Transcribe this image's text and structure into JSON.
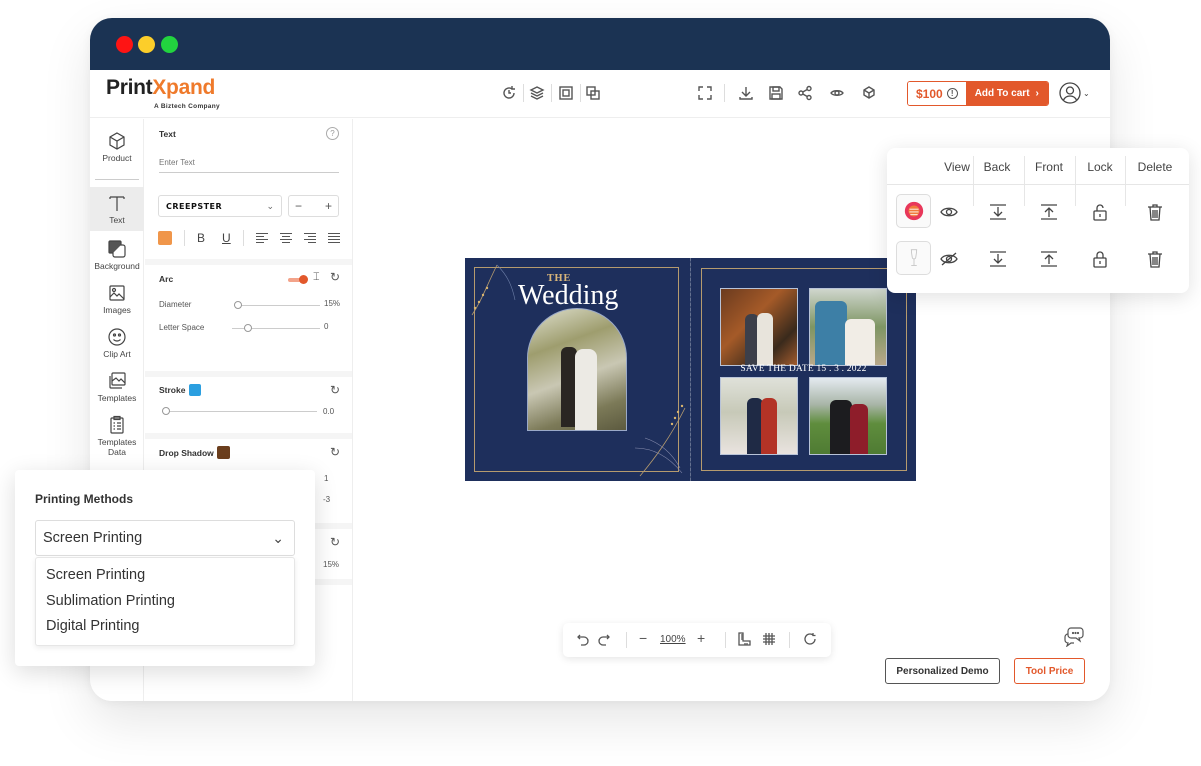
{
  "window": {
    "controls": [
      "close",
      "minimize",
      "maximize"
    ]
  },
  "brand": {
    "logo_main": "Print",
    "logo_accent": "Xpand",
    "tagline": "A Biztech Company",
    "accent_color": "#e2582b"
  },
  "toolbar": {
    "left_icons": [
      "refresh-icon",
      "layers-icon",
      "group-icon",
      "ungroup-icon"
    ],
    "right_icons": [
      "fullscreen-icon",
      "download-icon",
      "save-icon",
      "share-icon",
      "preview-icon",
      "3d-view-icon"
    ],
    "price": "$100",
    "info_symbol": "!",
    "add_to_cart": "Add To cart",
    "add_to_cart_chevron": "›",
    "user_chevron": "⌄"
  },
  "sidebar": {
    "items": [
      {
        "label": "Product",
        "icon": "cube-icon"
      },
      {
        "label": "Text",
        "icon": "text-icon",
        "active": true
      },
      {
        "label": "Background",
        "icon": "background-icon"
      },
      {
        "label": "Images",
        "icon": "image-icon"
      },
      {
        "label": "Clip Art",
        "icon": "smiley-icon"
      },
      {
        "label": "Templates",
        "icon": "templates-icon"
      },
      {
        "label": "Templates",
        "label2": "Data",
        "icon": "clipboard-list-icon"
      }
    ]
  },
  "text_panel": {
    "title": "Text",
    "help": "?",
    "input_placeholder": "Enter Text",
    "input_value": "",
    "font": "CREEPSTER",
    "font_chevron": "⌄",
    "stepper_minus": "−",
    "stepper_plus": "+",
    "text_color": "#f0964a",
    "bold": "B",
    "underline": "U",
    "arc": {
      "title": "Arc",
      "enabled": true,
      "diameter_label": "Diameter",
      "diameter_value": "15%",
      "diameter_fraction": 0.0,
      "letter_space_label": "Letter Space",
      "letter_space_value": "0",
      "letter_space_fraction": 0.15
    },
    "stroke": {
      "title": "Stroke",
      "color": "#2b9fe0",
      "value": "0.0",
      "fraction": 0.0
    },
    "drop_shadow": {
      "title": "Drop Shadow",
      "color": "#6b3e1d",
      "value1": "1",
      "value2": "-3"
    },
    "extra": {
      "value": "15%"
    },
    "reset_symbol": "↻"
  },
  "printing_methods": {
    "title": "Printing Methods",
    "selected": "Screen Printing",
    "chevron": "⌄",
    "options": [
      "Screen Printing",
      "Sublimation Printing",
      "Digital Printing"
    ]
  },
  "design": {
    "background_color": "#1e2f5c",
    "the": "THE",
    "title": "Wedding",
    "save_the_date": "SAVE THE DATE 15 . 3 . 2022"
  },
  "layers_panel": {
    "columns": [
      "View",
      "Back",
      "Front",
      "Lock",
      "Delete"
    ],
    "rows": [
      {
        "thumb": "badge-thumbnail",
        "visible": true,
        "locked": false
      },
      {
        "thumb": "wine-glass-thumbnail",
        "visible": false,
        "locked": true
      }
    ]
  },
  "zoom_bar": {
    "zoom_level": "100%",
    "minus": "−",
    "plus": "+"
  },
  "footer": {
    "personalized_demo": "Personalized Demo",
    "tool_price": "Tool Price"
  }
}
